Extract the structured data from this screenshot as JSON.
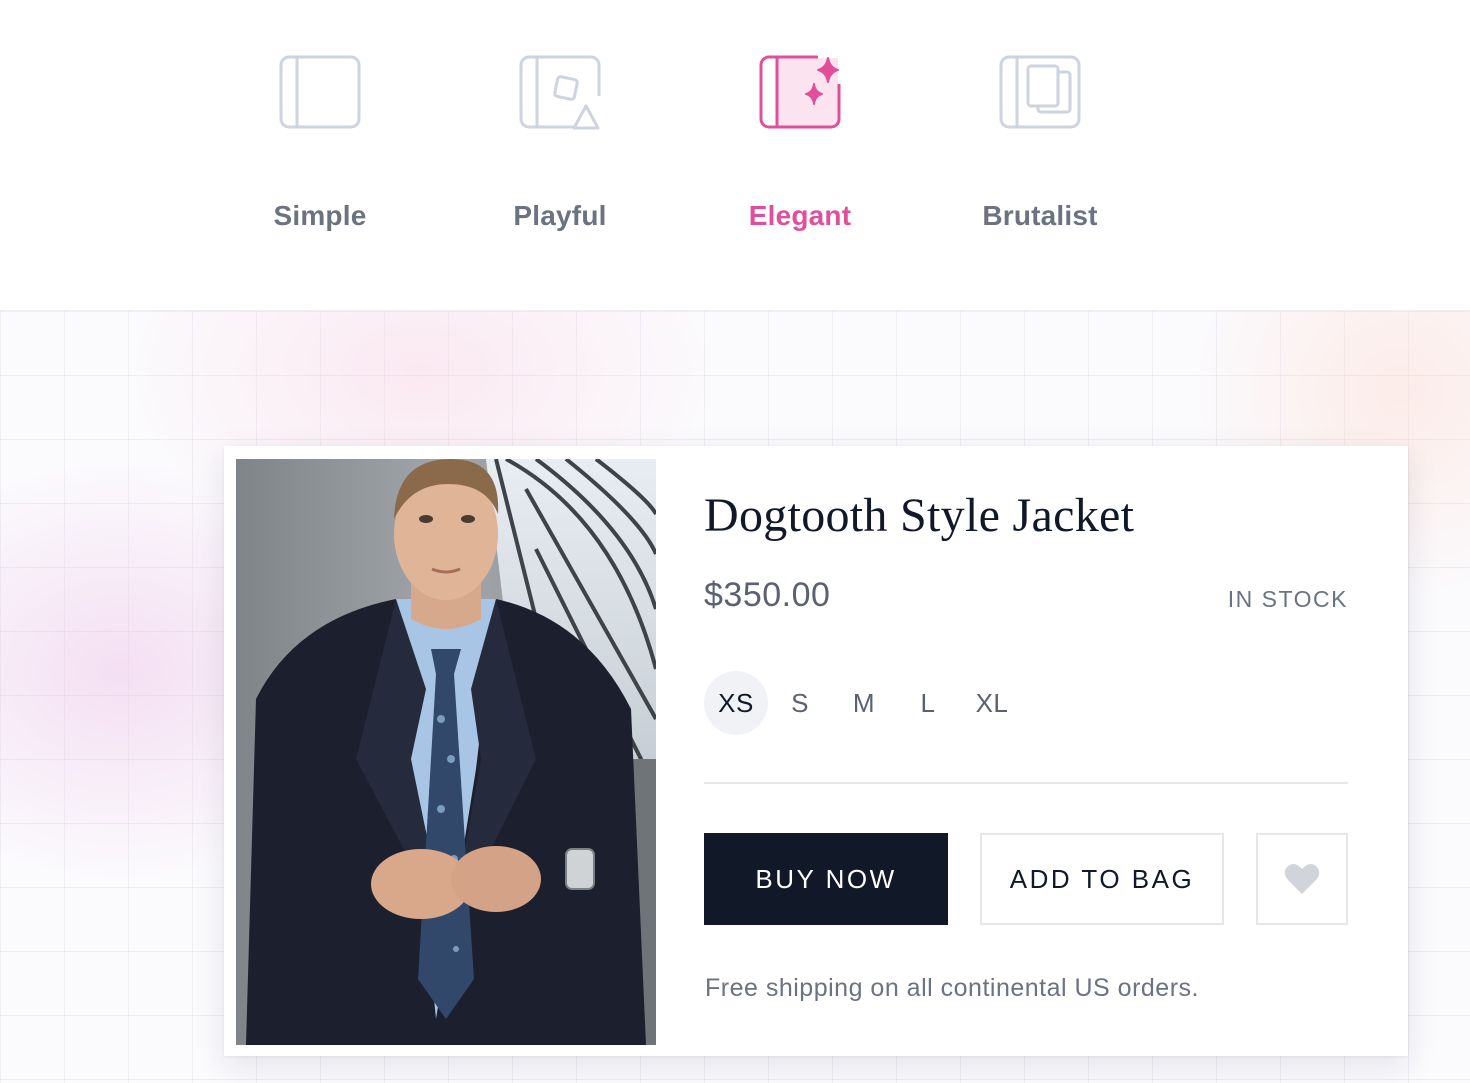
{
  "style_tabs": {
    "items": [
      {
        "label": "Simple",
        "icon": "panel-icon"
      },
      {
        "label": "Playful",
        "icon": "shapes-icon"
      },
      {
        "label": "Elegant",
        "icon": "sparkles-icon"
      },
      {
        "label": "Brutalist",
        "icon": "stacked-squares-icon"
      }
    ],
    "active": "Elegant",
    "active_color": "#e0509a",
    "inactive_color": "#6b7280"
  },
  "product": {
    "title": "Dogtooth Style Jacket",
    "price": "$350.00",
    "stock_status": "IN STOCK",
    "sizes": [
      "XS",
      "S",
      "M",
      "L",
      "XL"
    ],
    "selected_size": "XS",
    "buy_label": "BUY NOW",
    "bag_label": "ADD TO BAG",
    "favorite_icon": "heart-icon",
    "shipping_note": "Free shipping on all continental US orders.",
    "image": "man-in-dark-suit-photo"
  },
  "colors": {
    "primary_button": "#111827",
    "accent": "#e0509a"
  }
}
